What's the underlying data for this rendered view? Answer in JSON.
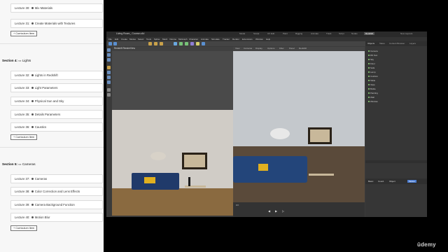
{
  "curriculum": {
    "lectures_top": [
      {
        "label": "Lecture 30: ",
        "title": "Mix Materials"
      },
      {
        "label": "Lecture 31: ",
        "title": "Create Materials with Textures"
      }
    ],
    "add_item_label": "+ Curriculum Item",
    "section4": {
      "label": "Section 4:",
      "title": "Lights",
      "lectures": [
        {
          "label": "Lecture 32: ",
          "title": "Lights in Redshift"
        },
        {
          "label": "Lecture 33: ",
          "title": "Light Parameters"
        },
        {
          "label": "Lecture 34: ",
          "title": "Physical Sun and Sky"
        },
        {
          "label": "Lecture 35: ",
          "title": "Details Parameters"
        },
        {
          "label": "Lecture 36: ",
          "title": "Caustics"
        }
      ]
    },
    "section5": {
      "label": "Section 5:",
      "title": "Cameras",
      "lectures": [
        {
          "label": "Lecture 37: ",
          "title": "Cameras"
        },
        {
          "label": "Lecture 38: ",
          "title": "Color Correction and Lens Effects"
        },
        {
          "label": "Lecture 39: ",
          "title": "Camera Background Function"
        },
        {
          "label": "Lecture 40: ",
          "title": "Motion Blur"
        }
      ]
    }
  },
  "app": {
    "title": "Living Room_ Course.c4d",
    "layouts": [
      "Model",
      "Sculpt",
      "UV Edit",
      "Paint",
      "Rigging",
      "Animate",
      "Track",
      "Script",
      "Nodes",
      "Redshift"
    ],
    "new_layouts": "New Layouts",
    "menus": [
      "File",
      "Edit",
      "Create",
      "Modes",
      "Select",
      "Tools",
      "Spline",
      "Mesh",
      "Volume",
      "MoGraph",
      "Character",
      "Animate",
      "Simulate",
      "Tracker",
      "Render",
      "Extensions",
      "Window",
      "Help"
    ],
    "viewport_left_name": "Redshift RenderView",
    "viewport_right_menus": [
      "View",
      "Cameras",
      "Display",
      "Options",
      "Filter",
      "Panel",
      "Redshift"
    ],
    "objects": [
      "Objects",
      "Takes",
      "Content Browser",
      "Layers",
      "Structure"
    ],
    "object_list": [
      "Camera",
      "RS Sun",
      "Sky",
      "Floor",
      "Sofa",
      "Lamp",
      "Cushion",
      "Table",
      "Vase",
      "Bottle",
      "Painting",
      "Wall",
      "Window"
    ],
    "attributes_tabs": [
      "Basic",
      "Coord.",
      "Object",
      "Motion"
    ],
    "frame": "0 F"
  },
  "watermark": "ûdemy"
}
